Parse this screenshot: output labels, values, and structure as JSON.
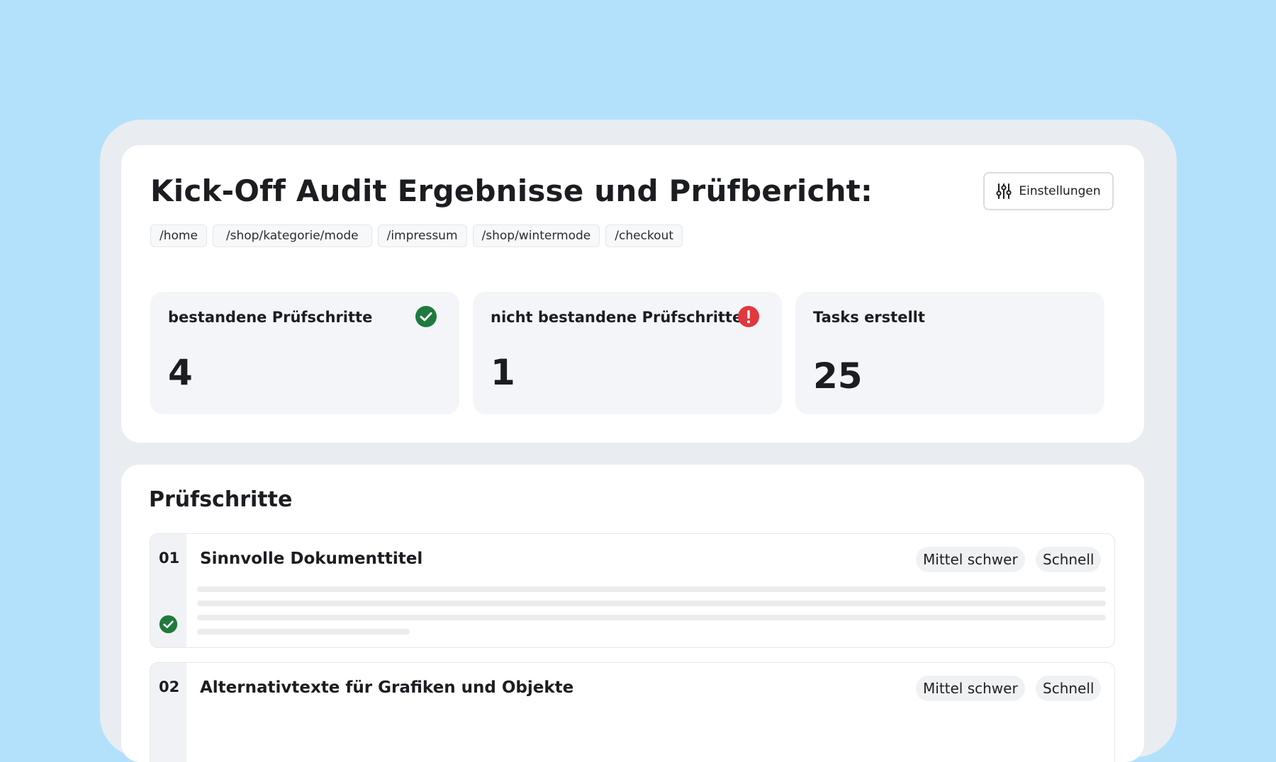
{
  "header": {
    "title": "Kick-Off Audit Ergebnisse und Prüfbericht:",
    "settings_label": "Einstellungen",
    "settings_icon": "sliders-icon"
  },
  "paths": [
    "/home",
    "/shop/kategorie/mode",
    "/impressum",
    "/shop/wintermode",
    "/checkout"
  ],
  "stats": [
    {
      "label": "bestandene Prüfschritte",
      "value": "4",
      "icon": "check-circle-icon",
      "color": "#1f7a3d"
    },
    {
      "label": "nicht bestandene Prüfschritte",
      "value": "1",
      "icon": "alert-circle-icon",
      "color": "#e0383e"
    },
    {
      "label": "Tasks erstellt",
      "value": "25"
    }
  ],
  "section": {
    "title": "Prüfschritte",
    "steps": [
      {
        "number": "01",
        "title": "Sinnvolle Dokumenttitel",
        "difficulty": "Mittel schwer",
        "speed": "Schnell",
        "status": "check-circle-icon"
      },
      {
        "number": "02",
        "title": "Alternativtexte für Grafiken und Objekte",
        "difficulty": "Mittel schwer",
        "speed": "Schnell"
      }
    ]
  },
  "colors": {
    "background": "#b3e1fb",
    "success": "#1f7a3d",
    "error": "#e0383e"
  }
}
